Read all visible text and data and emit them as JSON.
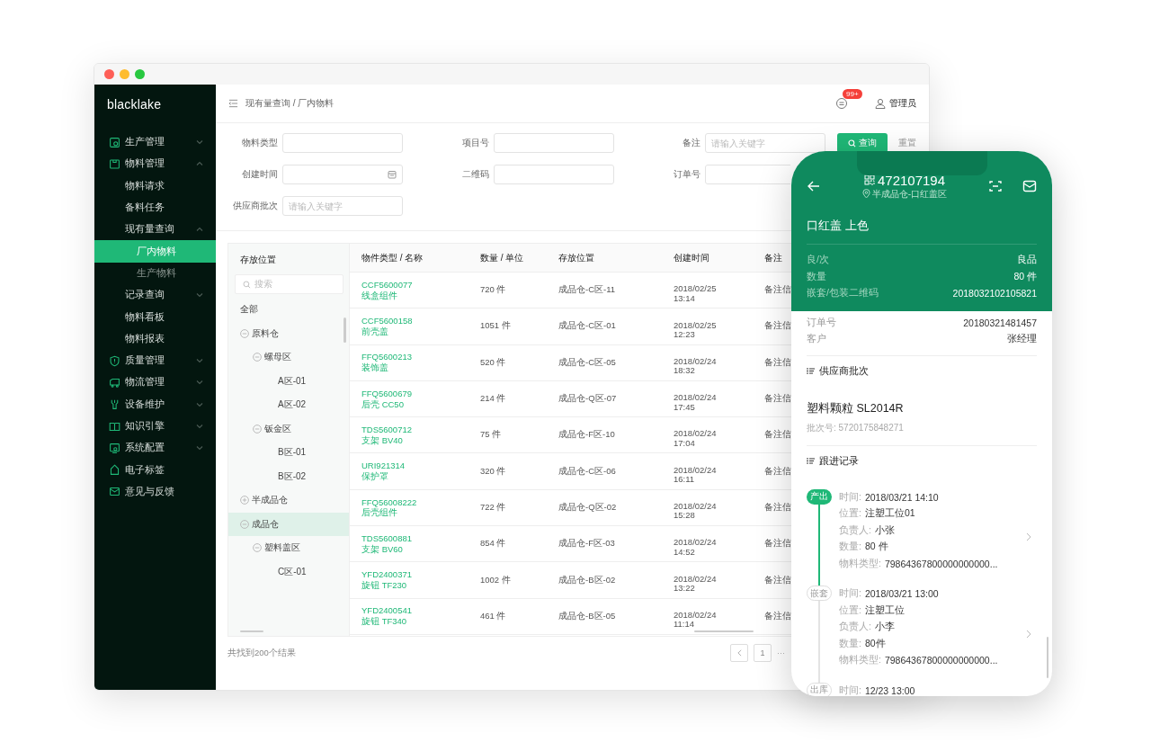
{
  "sidebar": {
    "logo": "blacklake",
    "items": [
      {
        "label": "生产管理",
        "expanded": false,
        "selected": false
      },
      {
        "label": "物料管理",
        "expanded": true,
        "selected": false,
        "children": [
          {
            "label": "物料请求",
            "selected": false
          },
          {
            "label": "备料任务",
            "selected": false
          },
          {
            "label": "现有量查询",
            "expanded": true,
            "selected": false,
            "children": [
              {
                "label": "厂内物料",
                "selected": true
              },
              {
                "label": "生产物料",
                "selected": false
              }
            ]
          },
          {
            "label": "记录查询",
            "expanded": false,
            "selected": false
          },
          {
            "label": "物料看板",
            "selected": false
          },
          {
            "label": "物料报表",
            "selected": false
          }
        ]
      },
      {
        "label": "质量管理",
        "expanded": false,
        "selected": false
      },
      {
        "label": "物流管理",
        "expanded": false,
        "selected": false
      },
      {
        "label": "设备维护",
        "expanded": false,
        "selected": false
      },
      {
        "label": "知识引擎",
        "expanded": false,
        "selected": false
      },
      {
        "label": "系统配置",
        "expanded": false,
        "selected": false
      },
      {
        "label": "电子标签",
        "selected": false
      },
      {
        "label": "意见与反馈",
        "selected": false
      }
    ]
  },
  "header": {
    "breadcrumb": "现有量查询 / 厂内物料",
    "notification_count": "99+",
    "user": "管理员"
  },
  "filters": [
    {
      "label": "物料类型",
      "kind": "text"
    },
    {
      "label": "项目号",
      "kind": "text"
    },
    {
      "label": "备注",
      "kind": "text",
      "placeholder": "请输入关键字"
    },
    {
      "label": "创建时间",
      "kind": "date"
    },
    {
      "label": "二维码",
      "kind": "text"
    },
    {
      "label": "订单号",
      "kind": "text"
    },
    {
      "label": "供应商批次",
      "kind": "text",
      "placeholder": "请输入关键字"
    }
  ],
  "filter_buttons": [
    {
      "label": "查询",
      "kind": "primary"
    },
    {
      "label": "重置",
      "kind": "plain"
    }
  ],
  "tree": {
    "title": "存放位置",
    "search_placeholder": "搜索",
    "nodes": [
      {
        "label": "全部",
        "selected": false
      },
      {
        "label": "原料仓",
        "expanded": true,
        "selected": false,
        "children": [
          {
            "label": "螺母区",
            "expanded": true,
            "selected": false,
            "children": [
              {
                "label": "A区-01",
                "selected": false
              },
              {
                "label": "A区-02",
                "selected": false
              }
            ]
          },
          {
            "label": "钣金区",
            "expanded": true,
            "selected": false,
            "children": [
              {
                "label": "B区-01",
                "selected": false
              },
              {
                "label": "B区-02",
                "selected": false
              }
            ]
          }
        ]
      },
      {
        "label": "半成品仓",
        "expanded": false,
        "selected": false
      },
      {
        "label": "成品仓",
        "expanded": true,
        "selected": true,
        "children": [
          {
            "label": "塑料盖区",
            "expanded": true,
            "selected": false,
            "children": [
              {
                "label": "C区-01",
                "selected": false
              }
            ]
          }
        ]
      }
    ]
  },
  "table": {
    "columns": [
      "物件类型 / 名称",
      "数量 / 单位",
      "存放位置",
      "创建时间",
      "备注"
    ],
    "rows": [
      {
        "code": "CCF5600077",
        "name": "线盒组件",
        "quantity": "720 件",
        "location": "成品仓-C区-11",
        "date": "2018/02/25",
        "time": "13:14",
        "note": "备注信"
      },
      {
        "code": "CCF5600158",
        "name": "前壳盖",
        "quantity": "1051 件",
        "location": "成品仓-C区-01",
        "date": "2018/02/25",
        "time": "12:23",
        "note": "备注信"
      },
      {
        "code": "FFQ5600213",
        "name": "装饰盖",
        "quantity": "520 件",
        "location": "成品仓-C区-05",
        "date": "2018/02/24",
        "time": "18:32",
        "note": "备注信"
      },
      {
        "code": "FFQ5600679",
        "name": "后壳 CC50",
        "quantity": "214 件",
        "location": "成品仓-Q区-07",
        "date": "2018/02/24",
        "time": "17:45",
        "note": "备注信"
      },
      {
        "code": "TDS5600712",
        "name": "支架 BV40",
        "quantity": "75 件",
        "location": "成品仓-F区-10",
        "date": "2018/02/24",
        "time": "17:04",
        "note": "备注信"
      },
      {
        "code": "URI921314",
        "name": "保护罩",
        "quantity": "320 件",
        "location": "成品仓-C区-06",
        "date": "2018/02/24",
        "time": "16:11",
        "note": "备注信"
      },
      {
        "code": "FFQ56008222",
        "name": "后壳组件",
        "quantity": "722 件",
        "location": "成品仓-Q区-02",
        "date": "2018/02/24",
        "time": "15:28",
        "note": "备注信"
      },
      {
        "code": "TDS5600881",
        "name": "支架 BV60",
        "quantity": "854 件",
        "location": "成品仓-F区-03",
        "date": "2018/02/24",
        "time": "14:52",
        "note": "备注信"
      },
      {
        "code": "YFD2400371",
        "name": "旋钮  TF230",
        "quantity": "1002 件",
        "location": "成品仓-B区-02",
        "date": "2018/02/24",
        "time": "13:22",
        "note": "备注信"
      },
      {
        "code": "YFD2400541",
        "name": "旋钮 TF340",
        "quantity": "461 件",
        "location": "成品仓-B区-05",
        "date": "2018/02/24",
        "time": "11:14",
        "note": "备注信"
      }
    ]
  },
  "footer": {
    "result_count": "共找到200个结果",
    "pages": [
      {
        "label": "1",
        "selected": false
      }
    ],
    "ellipsis": "···"
  },
  "phone": {
    "code": "472107194",
    "location": "半成品仓-口红盖区",
    "title": "口红盖 上色",
    "summary": [
      {
        "label": "良/次",
        "value": "良品"
      },
      {
        "label": "数量",
        "value": "80 件"
      },
      {
        "label": "嵌套/包装二维码",
        "value": "2018032102105821"
      }
    ],
    "details": [
      {
        "label": "订单号",
        "value": "20180321481457"
      },
      {
        "label": "客户",
        "value": "张经理"
      }
    ],
    "supplier_section": "供应商批次",
    "supplier_item": "塑料颗粒 SL2014R",
    "batch_no": "批次号: 5720175848271",
    "records_section": "跟进记录",
    "records": [
      {
        "tag": "产出",
        "active": true,
        "expandable": true,
        "fields": [
          {
            "label": "时间:",
            "value": "2018/03/21 14:10"
          },
          {
            "label": "位置:",
            "value": "注塑工位01"
          },
          {
            "label": "负责人:",
            "value": "小张"
          },
          {
            "label": "数量:",
            "value": "80 件"
          },
          {
            "label": "物料类型:",
            "value": "79864367800000000000..."
          }
        ]
      },
      {
        "tag": "嵌套",
        "active": false,
        "expandable": true,
        "fields": [
          {
            "label": "时间:",
            "value": "2018/03/21 13:00"
          },
          {
            "label": "位置:",
            "value": "注塑工位"
          },
          {
            "label": "负责人:",
            "value": "小李"
          },
          {
            "label": "数量:",
            "value": "80件"
          },
          {
            "label": "物料类型:",
            "value": "79864367800000000000..."
          }
        ]
      },
      {
        "tag": "出库",
        "active": false,
        "expandable": false,
        "fields": [
          {
            "label": "时间:",
            "value": "12/23 13:00"
          }
        ]
      }
    ]
  }
}
